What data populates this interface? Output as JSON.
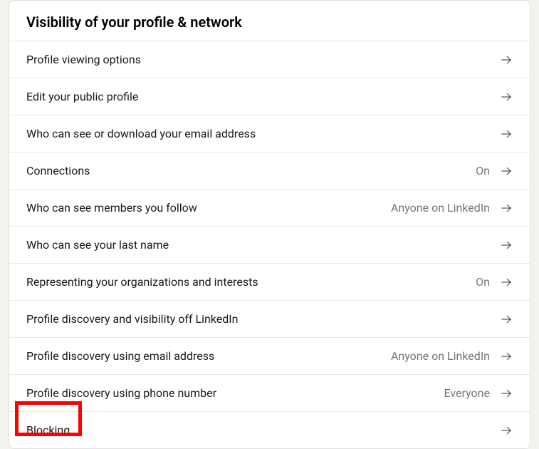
{
  "section": {
    "title": "Visibility of your profile & network",
    "rows": [
      {
        "label": "Profile viewing options",
        "value": ""
      },
      {
        "label": "Edit your public profile",
        "value": ""
      },
      {
        "label": "Who can see or download your email address",
        "value": ""
      },
      {
        "label": "Connections",
        "value": "On"
      },
      {
        "label": "Who can see members you follow",
        "value": "Anyone on LinkedIn"
      },
      {
        "label": "Who can see your last name",
        "value": ""
      },
      {
        "label": "Representing your organizations and interests",
        "value": "On"
      },
      {
        "label": "Profile discovery and visibility off LinkedIn",
        "value": ""
      },
      {
        "label": "Profile discovery using email address",
        "value": "Anyone on LinkedIn"
      },
      {
        "label": "Profile discovery using phone number",
        "value": "Everyone"
      },
      {
        "label": "Blocking",
        "value": ""
      }
    ]
  }
}
